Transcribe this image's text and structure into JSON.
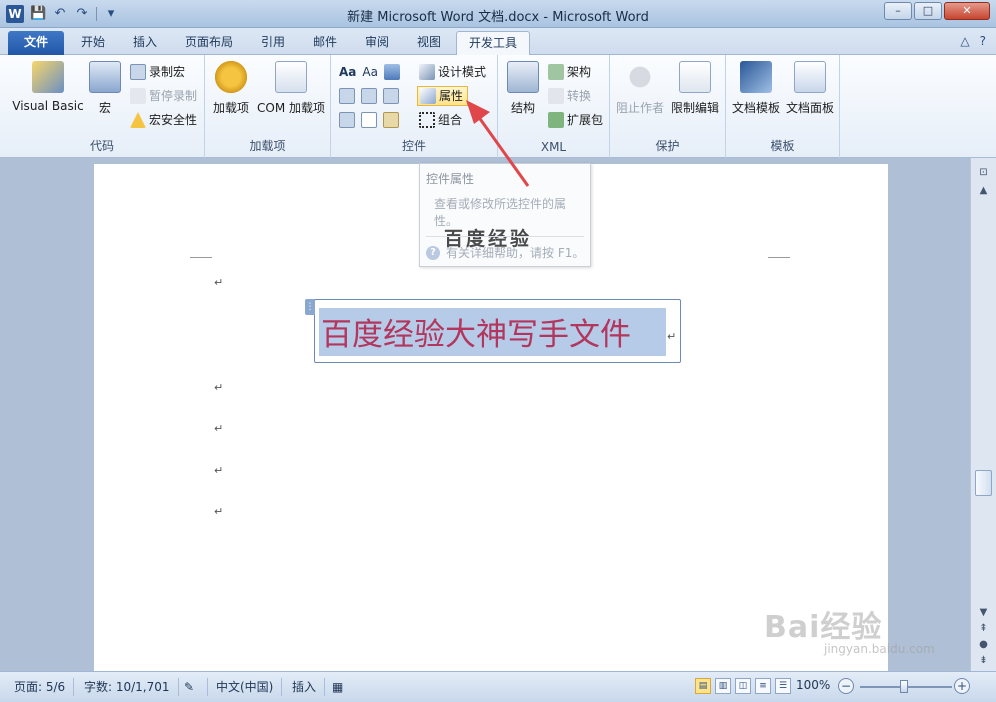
{
  "window": {
    "title": "新建 Microsoft Word 文档.docx - Microsoft Word",
    "minimize": "–",
    "maximize": "□",
    "close": "✕"
  },
  "qat": {
    "logo": "W",
    "save": "💾",
    "undo": "↶",
    "redo": "↷",
    "more": "▾"
  },
  "tabs": [
    {
      "label": "文件"
    },
    {
      "label": "开始"
    },
    {
      "label": "插入"
    },
    {
      "label": "页面布局"
    },
    {
      "label": "引用"
    },
    {
      "label": "邮件"
    },
    {
      "label": "审阅"
    },
    {
      "label": "视图"
    },
    {
      "label": "开发工具"
    }
  ],
  "tabright": {
    "collapse": "△",
    "help": "?"
  },
  "ribbon": {
    "code": {
      "name": "代码",
      "visual_basic": "Visual Basic",
      "macro": "宏",
      "record_macro": "录制宏",
      "pause_record": "暂停录制",
      "macro_security": "宏安全性"
    },
    "addins": {
      "name": "加载项",
      "addins": "加载项",
      "com_addins": "COM 加载项"
    },
    "controls": {
      "name": "控件",
      "design_mode": "设计模式",
      "properties": "属性",
      "group": "组合",
      "aa1": "Aa",
      "aa2": "Aa"
    },
    "xml": {
      "name": "XML",
      "structure": "结构",
      "schema": "架构",
      "transform": "转换",
      "expansion": "扩展包"
    },
    "protect": {
      "name": "保护",
      "block_authors": "阻止作者",
      "restrict_editing": "限制编辑"
    },
    "templates": {
      "name": "模板",
      "doc_template": "文档模板",
      "doc_panel": "文档面板"
    }
  },
  "tooltip": {
    "title": "控件属性",
    "desc": "查看或修改所选控件的属性。",
    "help": "有关详细帮助，请按 F1。",
    "overlay_text": "百度经验"
  },
  "document": {
    "control_text": "百度经验大神写手文件",
    "para_mark": "↵"
  },
  "status": {
    "page": "页面: 5/6",
    "words": "字数: 10/1,701",
    "language": "中文(中国)",
    "mode": "插入",
    "zoom": "100%",
    "zoom_level": 1.0
  },
  "watermark": {
    "brand": "Bai经验",
    "url": "jingyan.baidu.com"
  },
  "colors": {
    "accent": "#2257a8",
    "control_text": "#b2365d",
    "selection": "#b6cbe8",
    "annotation_arrow": "#e0474b"
  }
}
